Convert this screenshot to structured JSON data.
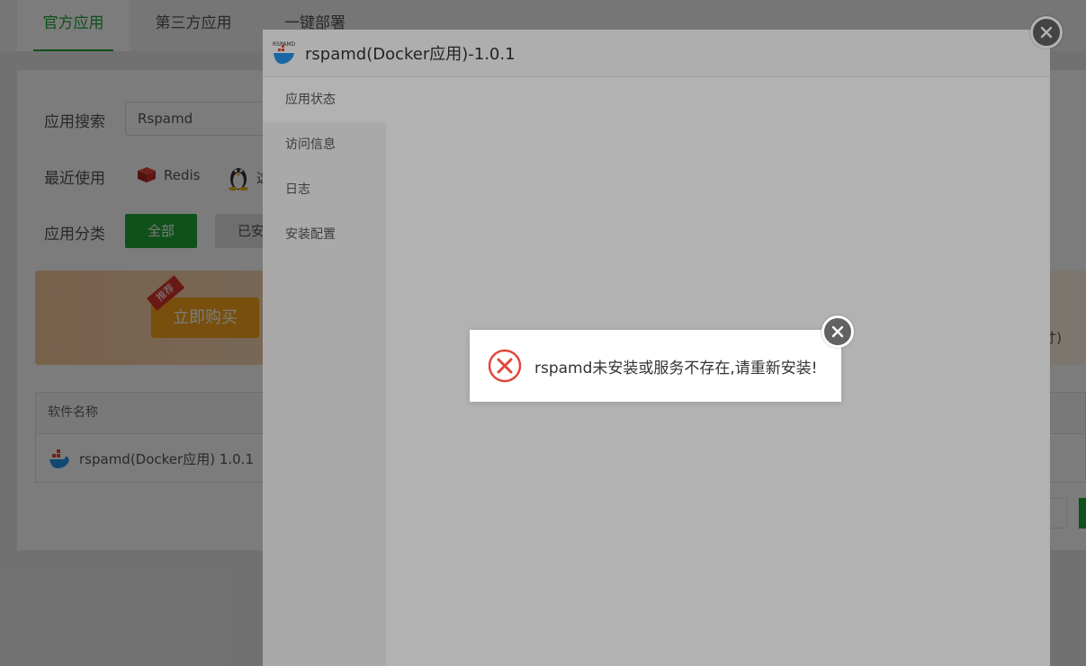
{
  "top_tabs": [
    "官方应用",
    "第三方应用",
    "一键部署"
  ],
  "search": {
    "label": "应用搜索",
    "value": "Rspamd"
  },
  "recent": {
    "label": "最近使用",
    "items": [
      "Redis",
      "这"
    ]
  },
  "category": {
    "label": "应用分类",
    "all": "全部",
    "installed": "已安"
  },
  "banner": {
    "badge": "推荐",
    "buy": "立即购买",
    "right_text": "寸)"
  },
  "table": {
    "header": "软件名称",
    "row_name": "rspamd(Docker应用) 1.0.1"
  },
  "modal": {
    "logo_text": "RSPAMD",
    "title": "rspamd(Docker应用)-1.0.1",
    "sidebar": [
      "应用状态",
      "访问信息",
      "日志",
      "安装配置"
    ]
  },
  "alert": {
    "message": "rspamd未安装或服务不存在,请重新安装!"
  },
  "colors": {
    "accent": "#20a53a",
    "error": "#e0483b",
    "buy_button": "#f7a21b"
  }
}
